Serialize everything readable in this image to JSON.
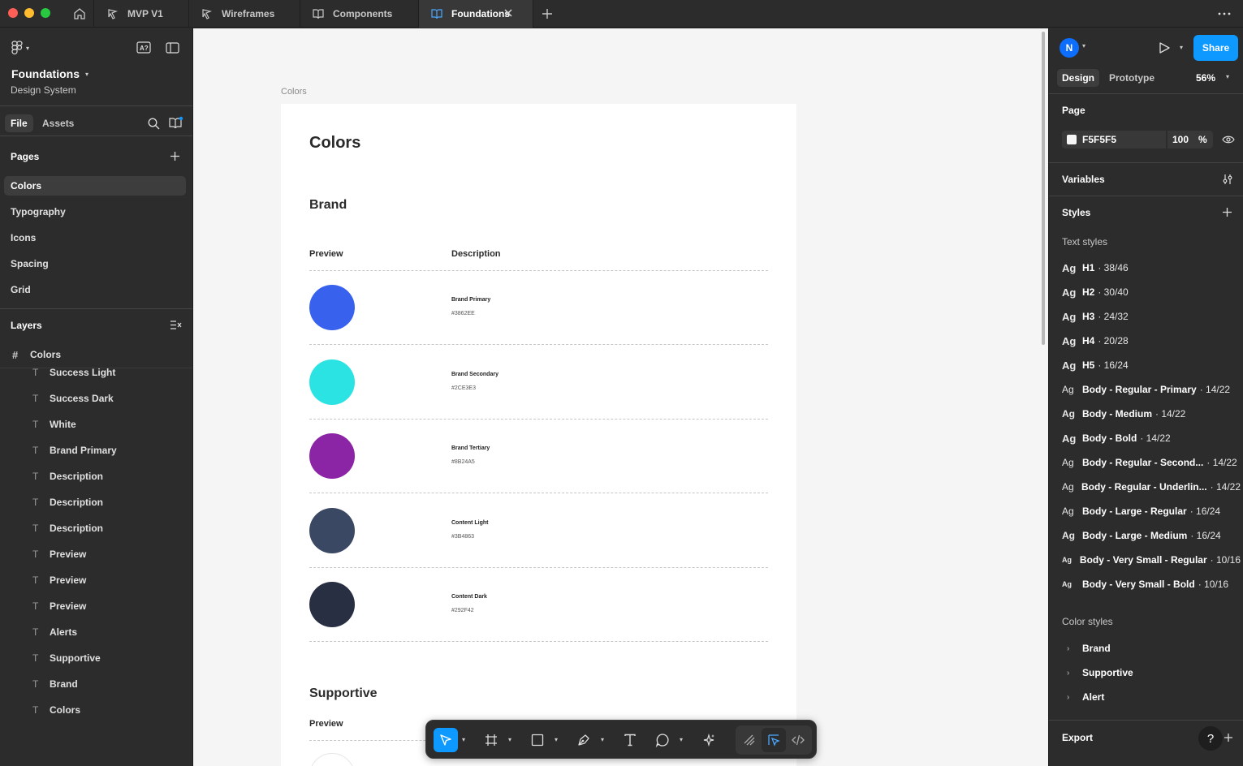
{
  "window": {
    "colors": {
      "close": "#ff5f57",
      "minimize": "#febc2e",
      "maximize": "#28c840"
    }
  },
  "tabs": [
    {
      "label": "MVP V1",
      "icon": "figjam-icon"
    },
    {
      "label": "Wireframes",
      "icon": "figjam-icon"
    },
    {
      "label": "Components",
      "icon": "book-icon"
    },
    {
      "label": "Foundations",
      "icon": "book-icon",
      "active": true
    }
  ],
  "left": {
    "file_name": "Foundations",
    "file_sub": "Design System",
    "tab_file": "File",
    "tab_assets": "Assets",
    "pages_title": "Pages",
    "pages": [
      "Colors",
      "Typography",
      "Icons",
      "Spacing",
      "Grid"
    ],
    "selected_page": "Colors",
    "layers_title": "Layers",
    "frame_layer": "Colors",
    "layers": [
      "Success Light",
      "Success Dark",
      "White",
      "Brand Primary",
      "Description",
      "Description",
      "Description",
      "Preview",
      "Preview",
      "Preview",
      "Alerts",
      "Supportive",
      "Brand",
      "Colors"
    ]
  },
  "canvas": {
    "frame_label": "Colors",
    "title": "Colors",
    "section1": "Brand",
    "col_preview": "Preview",
    "col_description": "Description",
    "swatches": [
      {
        "name": "Brand Primary",
        "hex": "#3862EE",
        "color": "#3862ee"
      },
      {
        "name": "Brand Secondary",
        "hex": "#2CE3E3",
        "color": "#2ce3e3"
      },
      {
        "name": "Brand Tertiary",
        "hex": "#8B24A5",
        "color": "#8b24a5"
      },
      {
        "name": "Content Light",
        "hex": "#3B4863",
        "color": "#3b4863"
      },
      {
        "name": "Content Dark",
        "hex": "#292F42",
        "color": "#292f42"
      }
    ],
    "section2": "Supportive",
    "col_preview2": "Preview"
  },
  "right": {
    "avatar": "N",
    "share": "Share",
    "tab_design": "Design",
    "tab_prototype": "Prototype",
    "zoom": "56%",
    "page_title": "Page",
    "page_fill": "F5F5F5",
    "page_opacity": "100",
    "page_pct": "%",
    "variables": "Variables",
    "styles": "Styles",
    "text_styles_title": "Text styles",
    "text_styles": [
      {
        "name": "H1",
        "size": "· 38/46",
        "weight": "bold"
      },
      {
        "name": "H2",
        "size": "· 30/40",
        "weight": "bold"
      },
      {
        "name": "H3",
        "size": "· 24/32",
        "weight": "bold"
      },
      {
        "name": "H4",
        "size": "· 20/28",
        "weight": "bold"
      },
      {
        "name": "H5",
        "size": "· 16/24",
        "weight": "bold"
      },
      {
        "name": "Body - Regular - Primary",
        "size": "· 14/22",
        "weight": "regular"
      },
      {
        "name": "Body - Medium",
        "size": "· 14/22",
        "weight": "medium"
      },
      {
        "name": "Body - Bold",
        "size": "· 14/22",
        "weight": "bold"
      },
      {
        "name": "Body - Regular - Second...",
        "size": "· 14/22",
        "weight": "regular"
      },
      {
        "name": "Body - Regular - Underlin...",
        "size": "· 14/22",
        "weight": "regular"
      },
      {
        "name": "Body - Large - Regular",
        "size": "· 16/24",
        "weight": "regular"
      },
      {
        "name": "Body - Large - Medium",
        "size": "· 16/24",
        "weight": "medium"
      },
      {
        "name": "Body - Very Small - Regular",
        "size": "· 10/16",
        "weight": "small"
      },
      {
        "name": "Body - Very Small - Bold",
        "size": "· 10/16",
        "weight": "small"
      }
    ],
    "color_styles_title": "Color styles",
    "color_styles": [
      "Brand",
      "Supportive",
      "Alert"
    ],
    "export": "Export",
    "help": "?"
  },
  "toolbar": {
    "tools": [
      "move-tool",
      "frame-tool",
      "rectangle-tool",
      "pen-tool",
      "text-tool",
      "comment-tool",
      "actions-tool"
    ],
    "modes": [
      "draw-mode",
      "design-mode",
      "dev-mode"
    ]
  }
}
